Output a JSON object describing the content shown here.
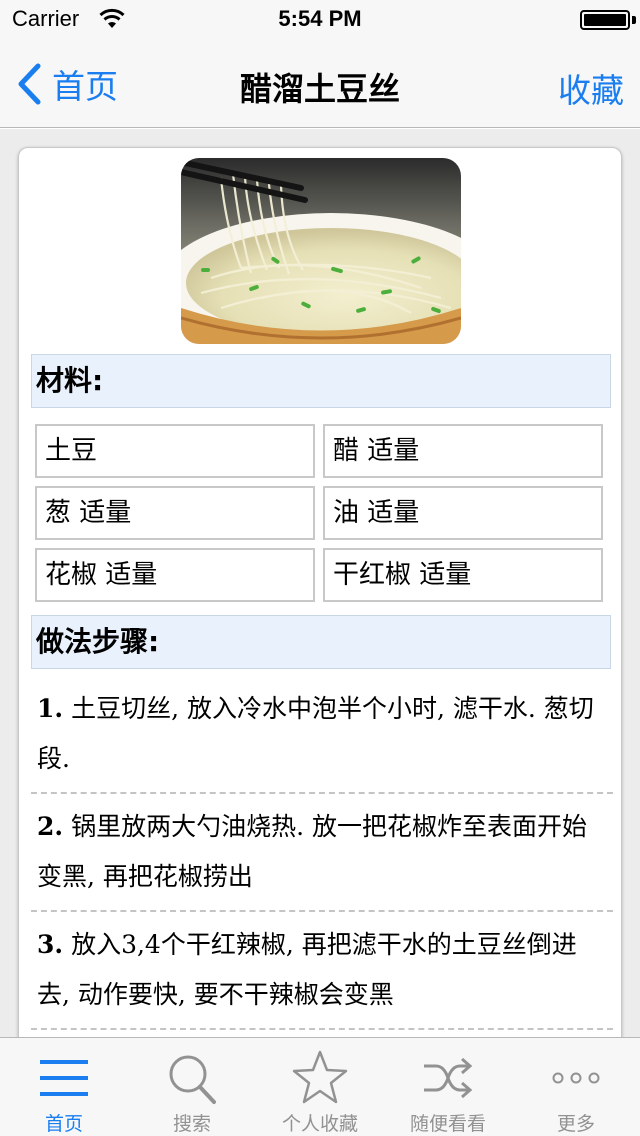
{
  "status_bar": {
    "carrier": "Carrier",
    "time": "5:54 PM"
  },
  "nav": {
    "back_label": "首页",
    "title": "醋溜土豆丝",
    "favorite_label": "收藏"
  },
  "recipe": {
    "ingredients_header": "材料:",
    "ingredients": [
      "土豆",
      "醋 适量",
      "葱 适量",
      "油 适量",
      "花椒 适量",
      "干红椒 适量"
    ],
    "steps_header": "做法步骤:",
    "steps": [
      {
        "num": "1.",
        "text": "土豆切丝, 放入冷水中泡半个小时, 滤干水. 葱切段."
      },
      {
        "num": "2.",
        "text": "锅里放两大勺油烧热. 放一把花椒炸至表面开始变黑, 再把花椒捞出"
      },
      {
        "num": "3.",
        "text": "放入3,4个干红辣椒, 再把滤干水的土豆丝倒进去, 动作要快, 要不干辣椒会变黑"
      }
    ]
  },
  "tab_bar": {
    "tabs": [
      {
        "label": "首页",
        "icon": "menu-icon",
        "active": true
      },
      {
        "label": "搜索",
        "icon": "search-icon",
        "active": false
      },
      {
        "label": "个人收藏",
        "icon": "star-icon",
        "active": false
      },
      {
        "label": "随便看看",
        "icon": "shuffle-icon",
        "active": false
      },
      {
        "label": "更多",
        "icon": "more-icon",
        "active": false
      }
    ]
  },
  "colors": {
    "accent": "#1a7ef0",
    "inactive": "#929292",
    "section_bg": "#e9f1fc"
  }
}
